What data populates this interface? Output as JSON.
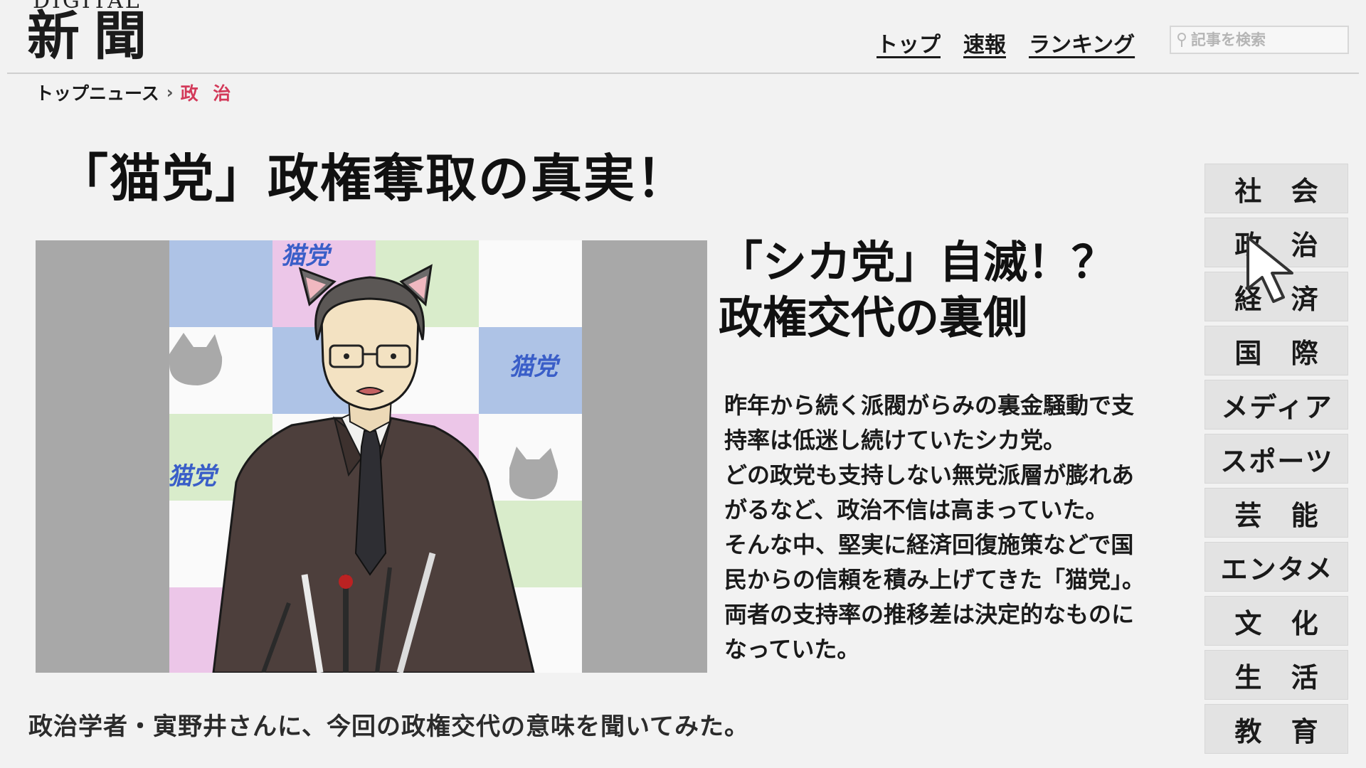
{
  "header": {
    "logo_small": "DIGITAL",
    "logo_main": "新聞",
    "nav": [
      "トップ",
      "速報",
      "ランキング"
    ],
    "search_placeholder": "記事を検索"
  },
  "breadcrumb": {
    "home": "トップニュース",
    "current": "政 治"
  },
  "article": {
    "headline": "「猫党」政権奪取の真実！",
    "image_logo_text": "猫党",
    "subhead_line1": "「シカ党」自滅！？",
    "subhead_line2": "政権交代の裏側",
    "body_lines": [
      "昨年から続く派閥がらみの裏金騒動で支",
      "持率は低迷し続けていたシカ党。",
      "どの政党も支持しない無党派層が膨れあ",
      "がるなど、政治不信は高まっていた。",
      "そんな中、堅実に経済回復施策などで国",
      "民からの信頼を積み上げてきた「猫党」。",
      "両者の支持率の推移差は決定的なものに",
      "なっていた。"
    ],
    "caption": "政治学者・寅野井さんに、今回の政権交代の意味を聞いてみた。"
  },
  "sidenav": [
    "社 会",
    "政 治",
    "経 済",
    "国 際",
    "メディア",
    "スポーツ",
    "芸 能",
    "エンタメ",
    "文 化",
    "生 活",
    "教 育"
  ],
  "colors": {
    "background": "#f2f2f2",
    "accent_breadcrumb": "#d33a5a",
    "party_logo": "#3a5ec8"
  },
  "icons": {
    "search": "search-icon",
    "cursor": "mouse-pointer-icon"
  }
}
